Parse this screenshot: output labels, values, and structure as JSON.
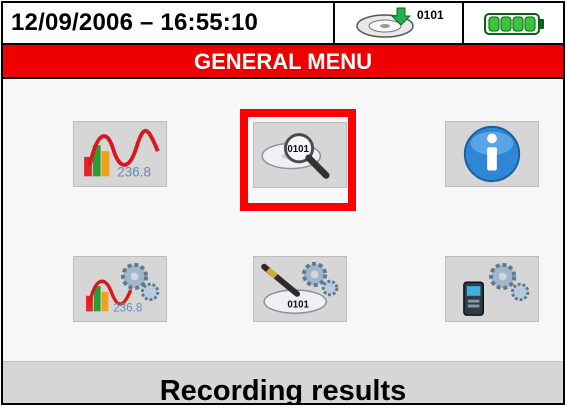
{
  "status_bar": {
    "datetime": "12/09/2006 – 16:55:10",
    "memory_label": "0101",
    "memory_icon": "disk-download-icon",
    "battery_icon": "battery-full-icon"
  },
  "title": "GENERAL MENU",
  "menu": {
    "items": [
      {
        "id": "real-time-values",
        "icon": "chart-waveform-icon",
        "tile_number": "236.8",
        "selected": false
      },
      {
        "id": "recording-results",
        "icon": "magnifier-binary-icon",
        "tile_number": "0101",
        "selected": true
      },
      {
        "id": "information",
        "icon": "info-icon",
        "selected": false
      },
      {
        "id": "analyzer-settings",
        "icon": "chart-gears-icon",
        "tile_number": "236.8",
        "selected": false
      },
      {
        "id": "recording-settings",
        "icon": "pen-disk-gears-icon",
        "tile_number": "0101",
        "selected": false
      },
      {
        "id": "general-settings",
        "icon": "device-gears-icon",
        "selected": false
      }
    ]
  },
  "status_text": "Recording results",
  "colors": {
    "title_bar": "#ee0000",
    "selection_frame": "#ff0000",
    "battery": "#3cc43c"
  }
}
